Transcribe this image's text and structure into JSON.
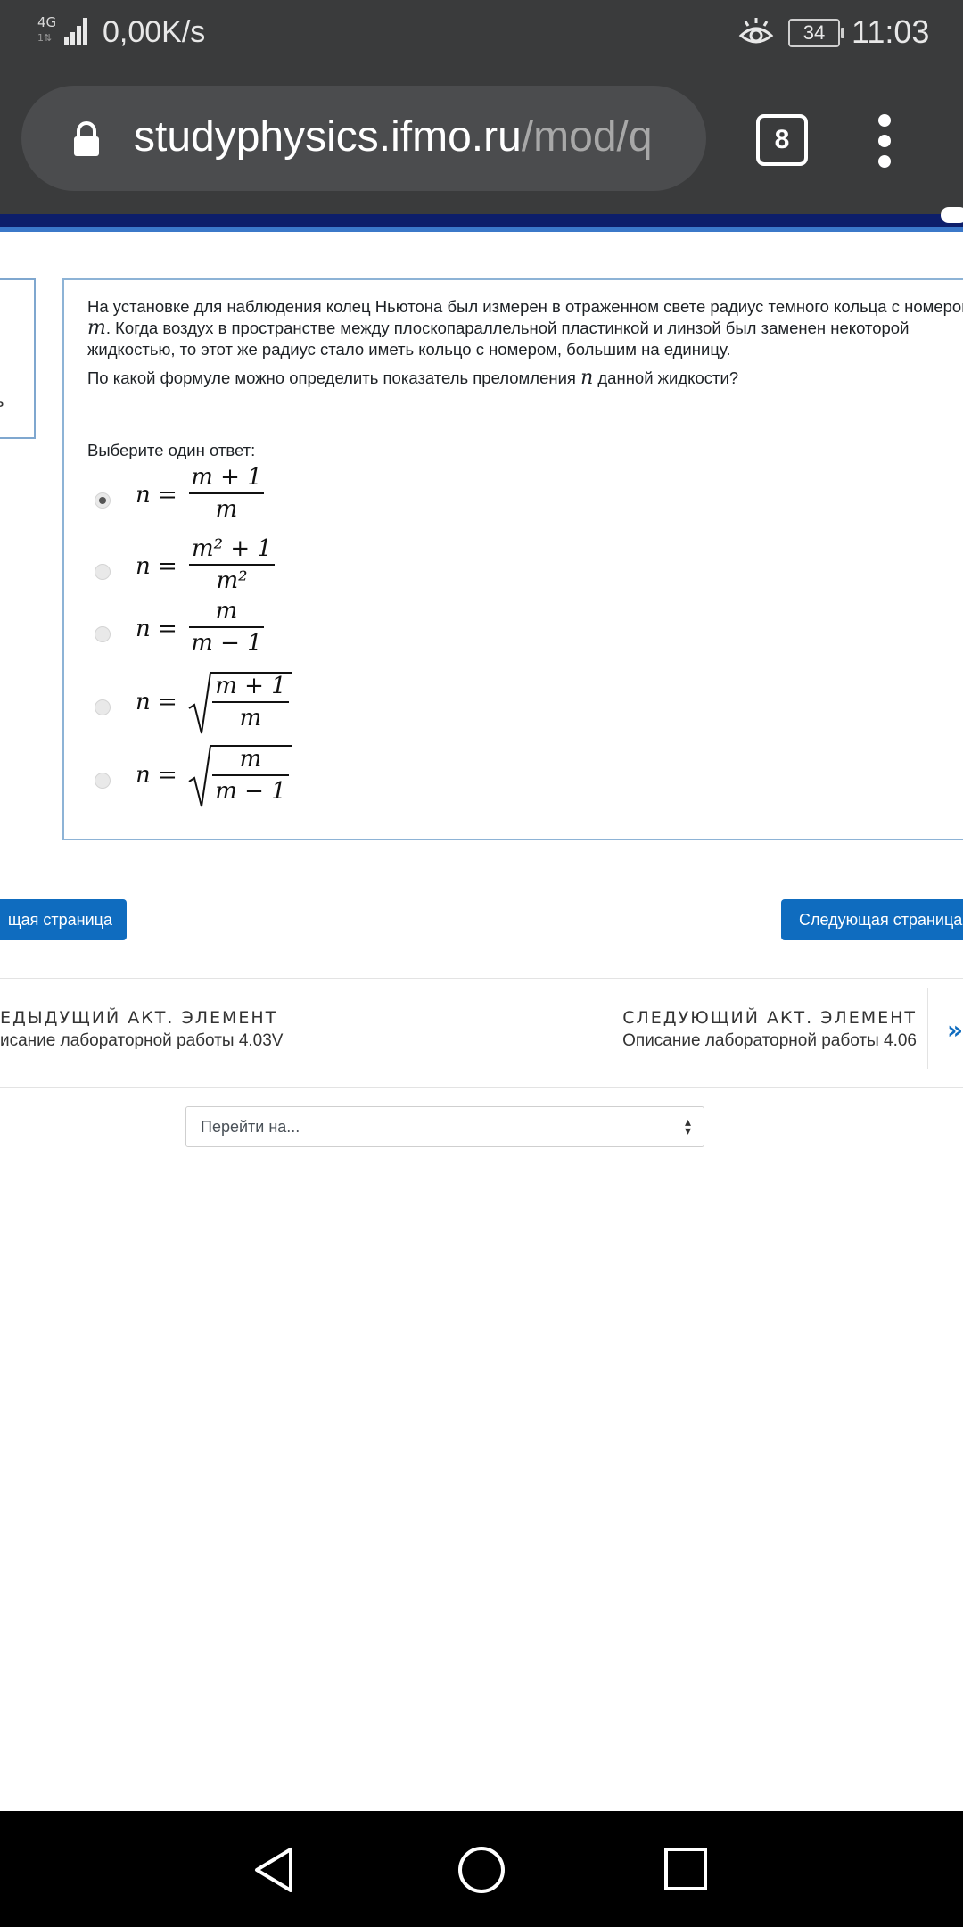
{
  "status_bar": {
    "network_type": "4G",
    "network_sub": "1⇅",
    "speed": "0,00K/s",
    "battery": "34",
    "time": "11:03"
  },
  "browser": {
    "url_host": "studyphysics.ifmo.ru",
    "url_path": "/mod/q",
    "tab_count": "8"
  },
  "left_panel_fragment": "ь",
  "question": {
    "paragraph1_a": "На установке для наблюдения колец Ньютона был измерен в отраженном свете радиус темного кольца с номером ",
    "paragraph1_var": "m",
    "paragraph1_b": ". Когда воздух в пространстве между плоскопараллельной пластинкой и линзой был заменен некоторой жидкостью, то этот же радиус стало иметь кольцо с номером, большим на единицу.",
    "paragraph2_a": "По какой формуле можно определить показатель преломления ",
    "paragraph2_var": "n",
    "paragraph2_b": " данной жидкости?",
    "prompt": "Выберите один ответ:",
    "options": [
      {
        "lhs": "n =",
        "num": "m + 1",
        "den": "m",
        "sqrt": false,
        "checked": true
      },
      {
        "lhs": "n =",
        "num": "m² + 1",
        "den": "m²",
        "sqrt": false,
        "checked": false
      },
      {
        "lhs": "n =",
        "num": "m",
        "den": "m − 1",
        "sqrt": false,
        "checked": false
      },
      {
        "lhs": "n =",
        "num": "m + 1",
        "den": "m",
        "sqrt": true,
        "checked": false
      },
      {
        "lhs": "n =",
        "num": "m",
        "den": "m − 1",
        "sqrt": true,
        "checked": false
      }
    ]
  },
  "buttons": {
    "prev": "щая страница",
    "next": "Следующая страница"
  },
  "activity_nav": {
    "prev_caption": "ЕДЫДУЩИЙ АКТ. ЭЛЕМЕНТ",
    "prev_title": "исание лабораторной работы 4.03V",
    "next_caption": "СЛЕДУЮЩИЙ АКТ. ЭЛЕМЕНТ",
    "next_title": "Описание лабораторной работы 4.06",
    "next_arrow": "»"
  },
  "jump_select": {
    "value": "Перейти на..."
  }
}
